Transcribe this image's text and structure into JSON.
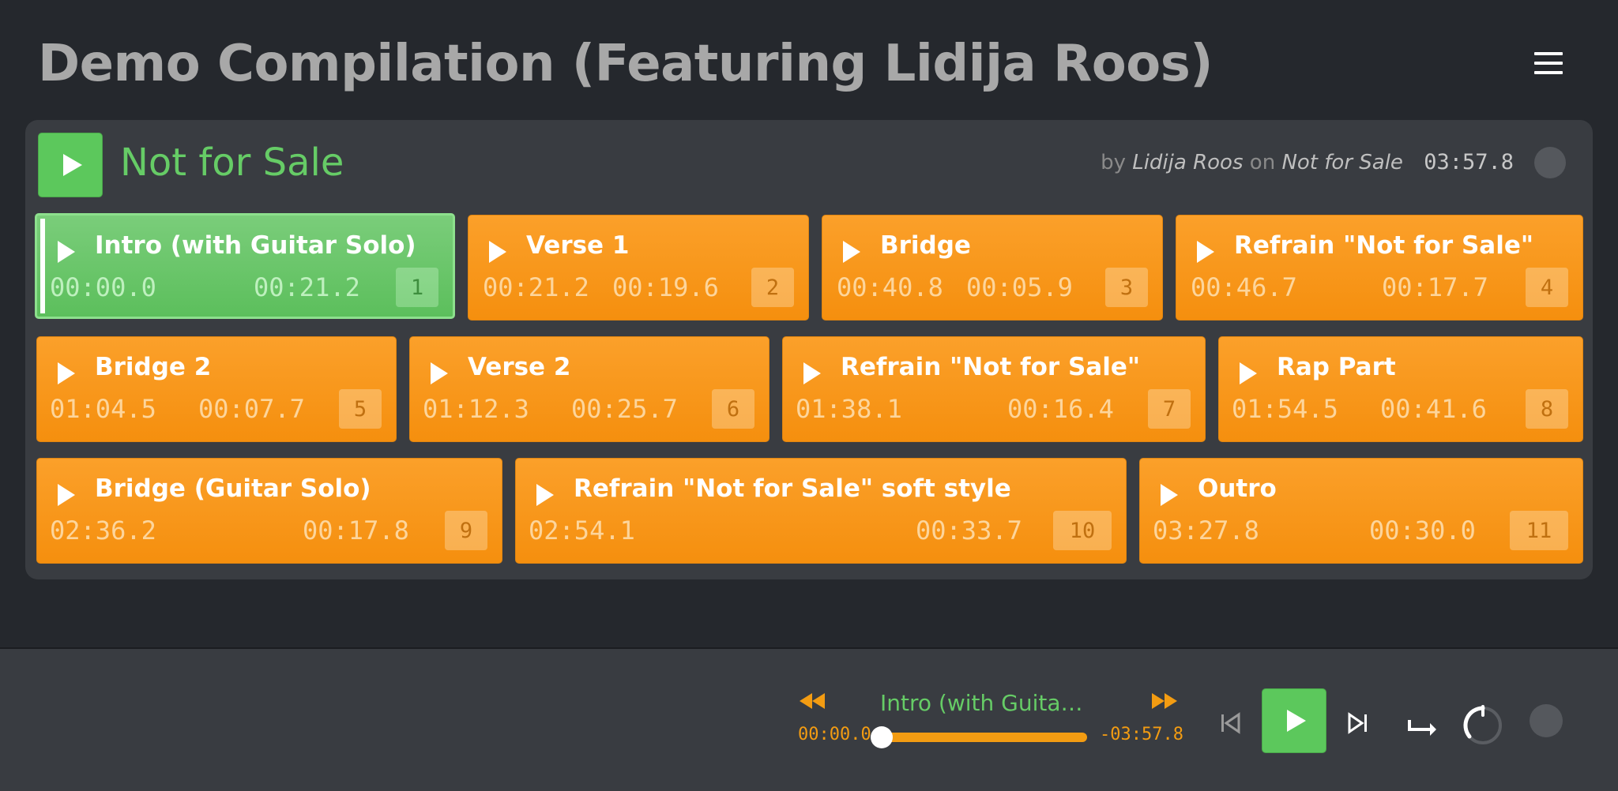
{
  "header": {
    "title": "Demo Compilation (Featuring Lidija Roos)",
    "menu_icon": "hamburger-icon"
  },
  "track": {
    "title": "Not for Sale",
    "by_label": "by",
    "artist": "Lidija Roos",
    "on_label": "on",
    "album": "Not for Sale",
    "duration": "03:57.8"
  },
  "cues": [
    {
      "title": "Intro (with Guitar Solo)",
      "start": "00:00.0",
      "duration": "00:21.2",
      "number": "1",
      "active": true
    },
    {
      "title": "Verse 1",
      "start": "00:21.2",
      "duration": "00:19.6",
      "number": "2"
    },
    {
      "title": "Bridge",
      "start": "00:40.8",
      "duration": "00:05.9",
      "number": "3"
    },
    {
      "title": "Refrain \"Not for Sale\"",
      "start": "00:46.7",
      "duration": "00:17.7",
      "number": "4"
    },
    {
      "title": "Bridge 2",
      "start": "01:04.5",
      "duration": "00:07.7",
      "number": "5"
    },
    {
      "title": "Verse 2",
      "start": "01:12.3",
      "duration": "00:25.7",
      "number": "6"
    },
    {
      "title": "Refrain \"Not for Sale\"",
      "start": "01:38.1",
      "duration": "00:16.4",
      "number": "7"
    },
    {
      "title": "Rap Part",
      "start": "01:54.5",
      "duration": "00:41.6",
      "number": "8"
    },
    {
      "title": "Bridge (Guitar Solo)",
      "start": "02:36.2",
      "duration": "00:17.8",
      "number": "9"
    },
    {
      "title": "Refrain \"Not for Sale\" soft style",
      "start": "02:54.1",
      "duration": "00:33.7",
      "number": "10"
    },
    {
      "title": "Outro",
      "start": "03:27.8",
      "duration": "00:30.0",
      "number": "11"
    }
  ],
  "player": {
    "now_playing": "Intro (with Guitar …",
    "elapsed": "00:00.0",
    "remaining": "-03:57.8",
    "progress": 0.0
  },
  "colors": {
    "accent_green": "#5cc85c",
    "accent_orange": "#f39c12",
    "background": "#25282d",
    "panel": "#393c41"
  }
}
